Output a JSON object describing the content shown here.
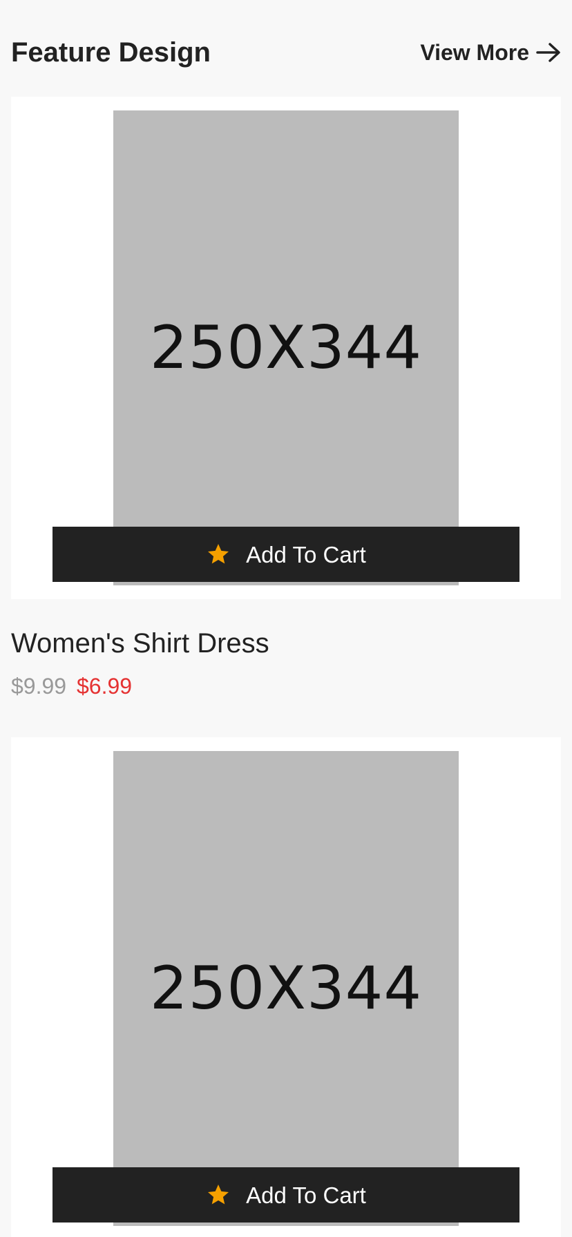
{
  "header": {
    "title": "Feature Design",
    "view_more_label": "View More"
  },
  "products": [
    {
      "image_label": "250X344",
      "cart_label": "Add To Cart",
      "name": "Women's Shirt Dress",
      "price_old": "$9.99",
      "price_new": "$6.99"
    },
    {
      "image_label": "250X344",
      "cart_label": "Add To Cart"
    }
  ],
  "colors": {
    "background": "#f8f8f8",
    "card": "#ffffff",
    "placeholder": "#bbbbbb",
    "cart_bar": "#222222",
    "star": "#f5a000",
    "price_old": "#999999",
    "price_new": "#e53232"
  },
  "icons": {
    "view_more": "arrow-right-icon",
    "cart": "star-icon"
  }
}
